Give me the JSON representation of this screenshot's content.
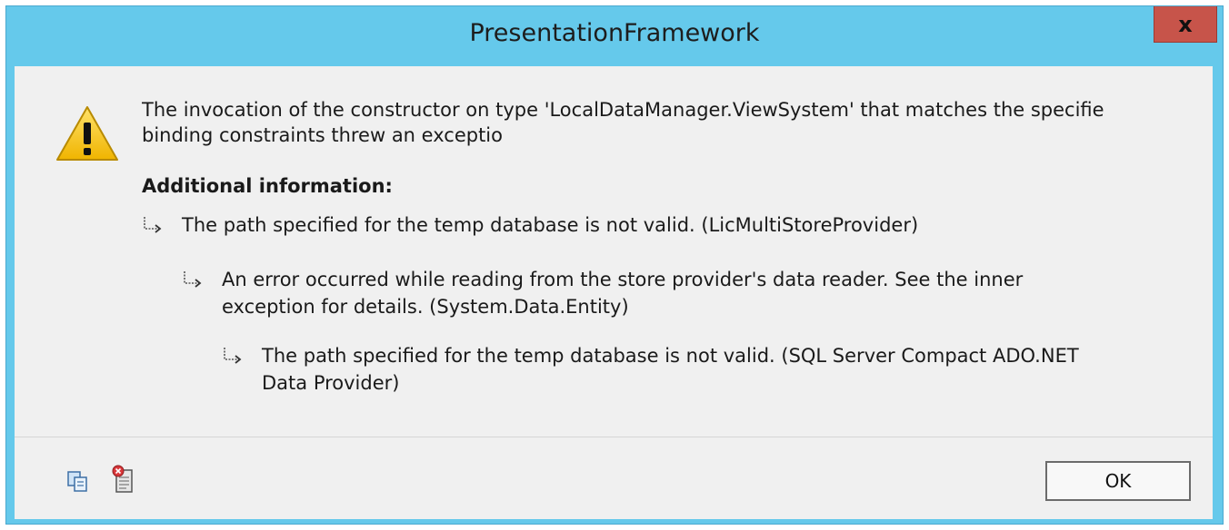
{
  "dialog": {
    "title": "PresentationFramework",
    "close_label": "x",
    "message": "The invocation of the constructor on type 'LocalDataManager.ViewSystem' that matches the specifie\nbinding constraints threw an exceptio",
    "additional_heading": "Additional information:",
    "details": [
      {
        "text": "The path specified for the temp database is not valid. (LicMultiStoreProvider)"
      },
      {
        "text": "An error occurred while reading from the store provider's data reader. See the inner\nexception for details. (System.Data.Entity)"
      },
      {
        "text": "The path specified for the temp database is not valid. (SQL Server Compact ADO.NET\nData Provider)"
      }
    ],
    "ok_label": "OK"
  },
  "colors": {
    "titlebar": "#65c9eb",
    "close": "#c7544a",
    "client": "#f0f0f0"
  },
  "icons": [
    "warning-icon",
    "copy-icon",
    "details-icon",
    "arrow-icon"
  ]
}
